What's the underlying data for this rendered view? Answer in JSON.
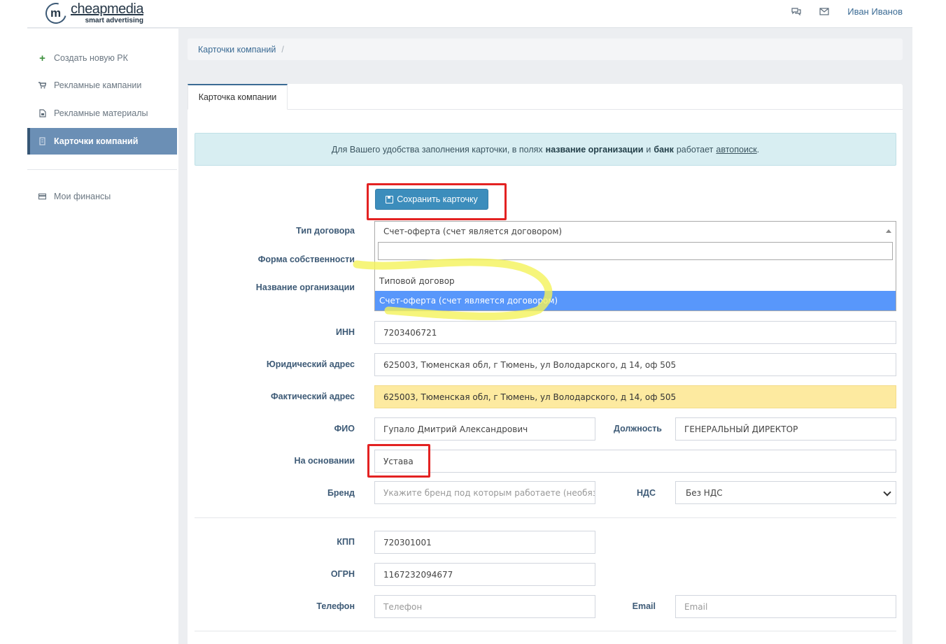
{
  "header": {
    "logo_name": "cheapmedia",
    "logo_tagline": "smart advertising",
    "logo_letter": "m",
    "user_name": "Иван Иванов",
    "icons": [
      "comments-icon",
      "envelope-icon"
    ]
  },
  "sidebar": {
    "items": [
      {
        "label": "Создать новую РК",
        "icon": "plus-icon"
      },
      {
        "label": "Рекламные кампании",
        "icon": "cart-icon"
      },
      {
        "label": "Рекламные материалы",
        "icon": "file-icon"
      },
      {
        "label": "Карточки компаний",
        "icon": "card-icon",
        "active": true
      },
      {
        "label": "Мои финансы",
        "icon": "credit-card-icon"
      }
    ]
  },
  "breadcrumb": {
    "item": "Карточки компаний",
    "separator": "/"
  },
  "tab": {
    "label": "Карточка компании"
  },
  "alert": {
    "text_before": "Для Вашего удобства заполнения карточки, в полях",
    "bold1": "название организации",
    "mid": "и",
    "bold2": "банк",
    "text_after": "работает",
    "link": "автопоиск",
    "end": "."
  },
  "save_button": {
    "label": "Сохранить карточку",
    "icon": "save-icon"
  },
  "form": {
    "contract_type": {
      "label": "Тип договора",
      "value": "Счет-оферта (счет является договором)",
      "search_value": "",
      "options": [
        "Типовой договор",
        "Счет-оферта (счет является договором)"
      ],
      "selected_index": 1
    },
    "ownership_label": "Форма собственности",
    "org_name_label": "Название организации",
    "inn": {
      "label": "ИНН",
      "value": "7203406721"
    },
    "legal_address": {
      "label": "Юридический адрес",
      "value": "625003, Тюменская обл, г Тюмень, ул Володарского, д 14, оф 505"
    },
    "actual_address": {
      "label": "Фактический адрес",
      "value": "625003, Тюменская обл, г Тюмень, ул Володарского, д 14, оф 505"
    },
    "fio": {
      "label": "ФИО",
      "value": "Гупало Дмитрий Александрович"
    },
    "position": {
      "label": "Должность",
      "value": "ГЕНЕРАЛЬНЫЙ ДИРЕКТОР"
    },
    "basis": {
      "label": "На основании",
      "value": "Устава"
    },
    "brand": {
      "label": "Бренд",
      "placeholder": "Укажите бренд под которым работаете (необязательно)"
    },
    "vat": {
      "label": "НДС",
      "value": "Без НДС"
    },
    "kpp": {
      "label": "КПП",
      "value": "720301001"
    },
    "ogrn": {
      "label": "ОГРН",
      "value": "1167232094677"
    },
    "phone": {
      "label": "Телефон",
      "placeholder": "Телефон"
    },
    "email": {
      "label": "Email",
      "placeholder": "Email"
    }
  },
  "annotation_colors": {
    "red_box": "#e32222",
    "yellow_highlight": "#f4f25a"
  }
}
